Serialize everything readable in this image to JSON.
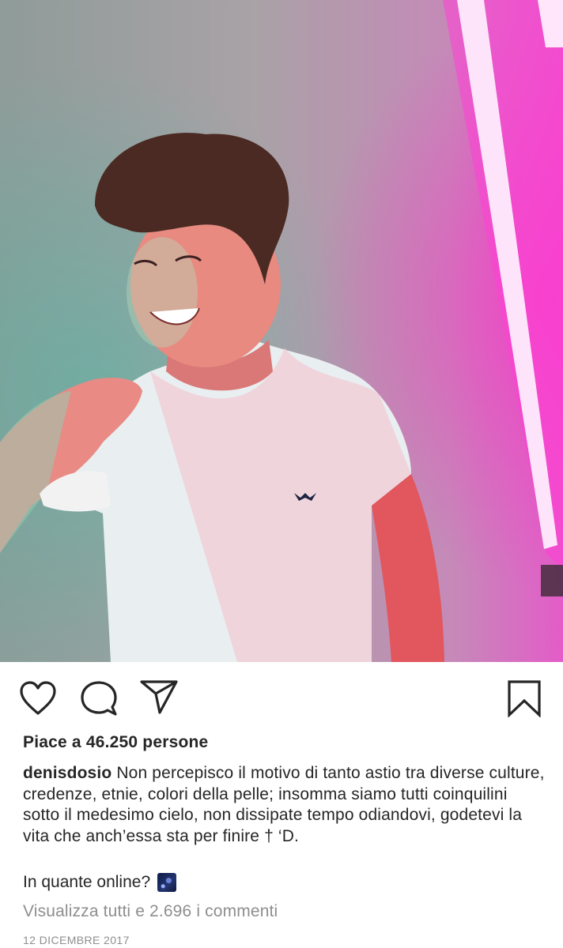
{
  "post": {
    "likes_text": "Piace a 46.250 persone",
    "username": "denisdosio",
    "caption_text": " Non percepisco il motivo di tanto astio tra diverse culture, credenze, etnie, colori della pelle; insomma siamo tutti coinquilini sotto il medesimo cielo, non dissipate tempo odiandovi, godetevi la vita che anch’essa sta per finire † ‘D.",
    "caption_question": "In quante online?",
    "emoji": "🌌",
    "view_comments_text": "Visualizza tutti e 2.696 i commenti",
    "date": "12 DICEMBRE 2017"
  },
  "icons": {
    "like": "heart-outline-icon",
    "comment": "speech-bubble-icon",
    "share": "paper-plane-icon",
    "save": "bookmark-outline-icon"
  },
  "colors": {
    "text": "#262626",
    "muted": "#8e8e8e",
    "neon_pink": "#ff2fd0"
  }
}
